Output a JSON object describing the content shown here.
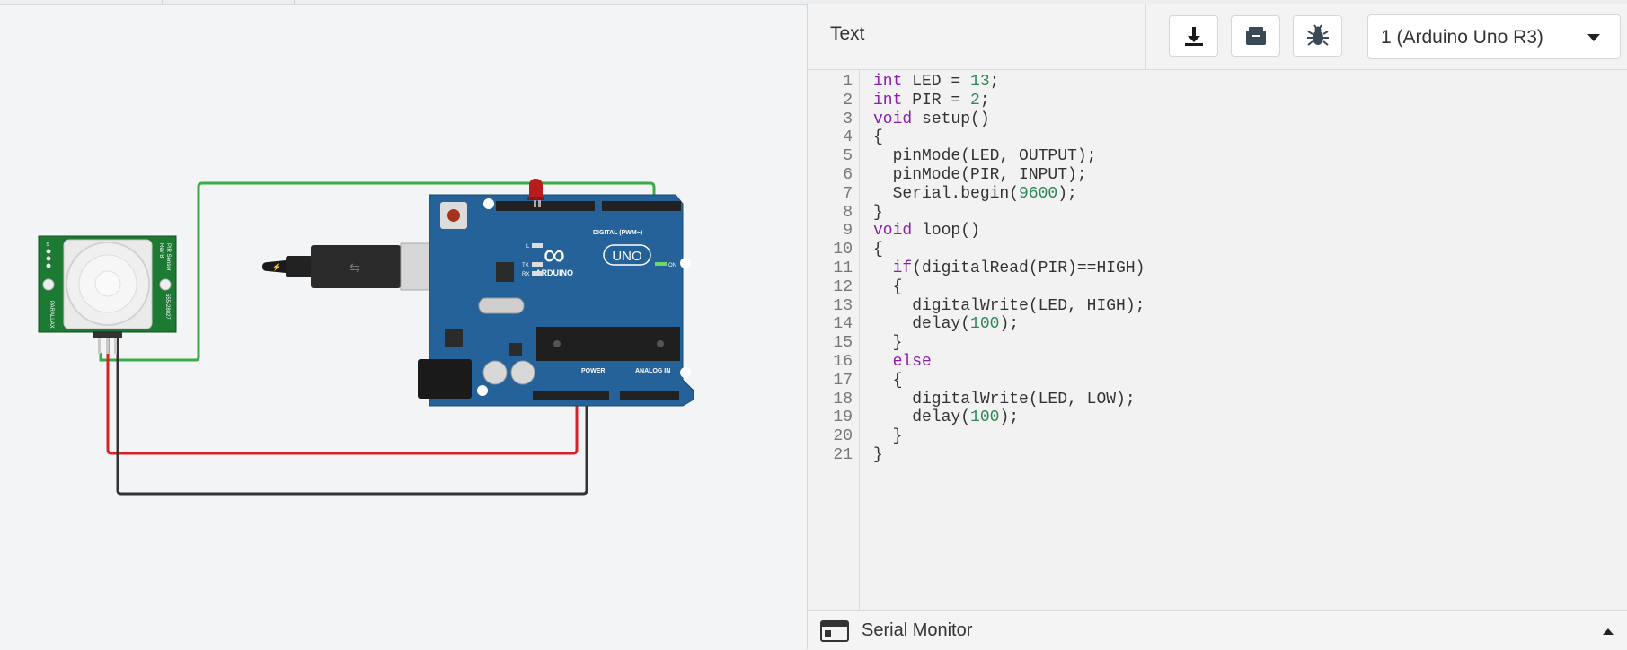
{
  "editor_header": {
    "mode": "Text",
    "device": "1 (Arduino Uno R3)",
    "icons": [
      "download-icon",
      "library-icon",
      "debugger-icon",
      "chevron-down-icon"
    ]
  },
  "code": {
    "line_numbers": [
      "1",
      "2",
      "3",
      "4",
      "5",
      "6",
      "7",
      "8",
      "9",
      "10",
      "11",
      "12",
      "13",
      "14",
      "15",
      "16",
      "17",
      "18",
      "19",
      "20",
      "21"
    ],
    "lines": [
      [
        {
          "t": "int",
          "c": "kw"
        },
        {
          "t": " LED = ",
          "c": ""
        },
        {
          "t": "13",
          "c": "num"
        },
        {
          "t": ";",
          "c": ""
        }
      ],
      [
        {
          "t": "int",
          "c": "kw"
        },
        {
          "t": " PIR = ",
          "c": ""
        },
        {
          "t": "2",
          "c": "num"
        },
        {
          "t": ";",
          "c": ""
        }
      ],
      [
        {
          "t": "void",
          "c": "kw"
        },
        {
          "t": " setup()",
          "c": ""
        }
      ],
      [
        {
          "t": "{",
          "c": ""
        }
      ],
      [
        {
          "t": "  pinMode(LED, OUTPUT);",
          "c": ""
        }
      ],
      [
        {
          "t": "  pinMode(PIR, INPUT);",
          "c": ""
        }
      ],
      [
        {
          "t": "  Serial.begin(",
          "c": ""
        },
        {
          "t": "9600",
          "c": "num"
        },
        {
          "t": ");",
          "c": ""
        }
      ],
      [
        {
          "t": "}",
          "c": ""
        }
      ],
      [
        {
          "t": "void",
          "c": "kw"
        },
        {
          "t": " loop()",
          "c": ""
        }
      ],
      [
        {
          "t": "{",
          "c": ""
        }
      ],
      [
        {
          "t": "  ",
          "c": ""
        },
        {
          "t": "if",
          "c": "kw"
        },
        {
          "t": "(digitalRead(PIR)==HIGH)",
          "c": ""
        }
      ],
      [
        {
          "t": "  {",
          "c": ""
        }
      ],
      [
        {
          "t": "    digitalWrite(LED, HIGH);",
          "c": ""
        }
      ],
      [
        {
          "t": "    delay(",
          "c": ""
        },
        {
          "t": "100",
          "c": "num"
        },
        {
          "t": ");",
          "c": ""
        }
      ],
      [
        {
          "t": "  }",
          "c": ""
        }
      ],
      [
        {
          "t": "  ",
          "c": ""
        },
        {
          "t": "else",
          "c": "kw"
        }
      ],
      [
        {
          "t": "  {",
          "c": ""
        }
      ],
      [
        {
          "t": "    digitalWrite(LED, LOW);",
          "c": ""
        }
      ],
      [
        {
          "t": "    delay(",
          "c": ""
        },
        {
          "t": "100",
          "c": "num"
        },
        {
          "t": ");",
          "c": ""
        }
      ],
      [
        {
          "t": "  }",
          "c": ""
        }
      ],
      [
        {
          "t": "}",
          "c": ""
        }
      ]
    ]
  },
  "serial_monitor": {
    "label": "Serial Monitor",
    "icons": [
      "serial-monitor-icon",
      "chevron-up-icon"
    ]
  },
  "circuit": {
    "pir_sensor": {
      "brand": "PARALLAX",
      "label": "PIR Sensor",
      "rev": "Rev B",
      "part_no": "555-28027",
      "pin_labels": [
        "S",
        "+",
        "-"
      ]
    },
    "arduino": {
      "model": "UNO",
      "brand": "ARDUINO",
      "digital_label": "DIGITAL (PWM~)",
      "power_label": "POWER",
      "analog_label": "ANALOG IN",
      "on_label": "ON",
      "led_labels": [
        "L",
        "TX",
        "RX"
      ],
      "top_pin_labels": [
        "AREF",
        "GND",
        "13",
        "12",
        "~11",
        "~10",
        "~9",
        "8",
        "7",
        "~6",
        "~5",
        "4",
        "~3",
        "2",
        "TX→1",
        "RX←0"
      ],
      "power_pin_labels": [
        "IOREF",
        "RESET",
        "3.3V",
        "5V",
        "GND",
        "GND",
        "Vin"
      ],
      "analog_pin_labels": [
        "A0",
        "A1",
        "A2",
        "A3",
        "A4",
        "A5"
      ]
    },
    "colors": {
      "wire_signal": "#3dab45",
      "wire_power": "#d6222a",
      "wire_ground": "#333333",
      "board": "#25629a",
      "sensor_pcb": "#1d7a32",
      "led": "#b81d1d",
      "keyword": "#8b1fa9",
      "number": "#318659"
    }
  }
}
